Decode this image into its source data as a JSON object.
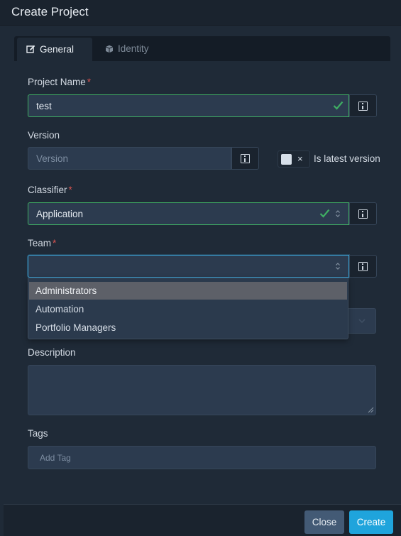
{
  "modal": {
    "title": "Create Project"
  },
  "tabs": [
    {
      "label": "General",
      "icon": "edit-icon",
      "active": true
    },
    {
      "label": "Identity",
      "icon": "cube-icon",
      "active": false
    }
  ],
  "form": {
    "project_name": {
      "label": "Project Name",
      "required_mark": "*",
      "value": "test"
    },
    "version": {
      "label": "Version",
      "placeholder": "Version"
    },
    "is_latest": {
      "label": "Is latest version",
      "toggle_symbol": "×",
      "checked": false
    },
    "classifier": {
      "label": "Classifier",
      "required_mark": "*",
      "value": "Application"
    },
    "team": {
      "label": "Team",
      "required_mark": "*",
      "value": "",
      "options": [
        "Administrators",
        "Automation",
        "Portfolio Managers"
      ],
      "highlighted_index": 0
    },
    "description": {
      "label": "Description",
      "value": ""
    },
    "tags": {
      "label": "Tags",
      "placeholder": "Add Tag"
    }
  },
  "footer": {
    "close_label": "Close",
    "create_label": "Create"
  },
  "colors": {
    "valid": "#3fae63",
    "primary": "#1fa4dc",
    "required": "#d9534f",
    "focus": "#3aa3d6"
  }
}
